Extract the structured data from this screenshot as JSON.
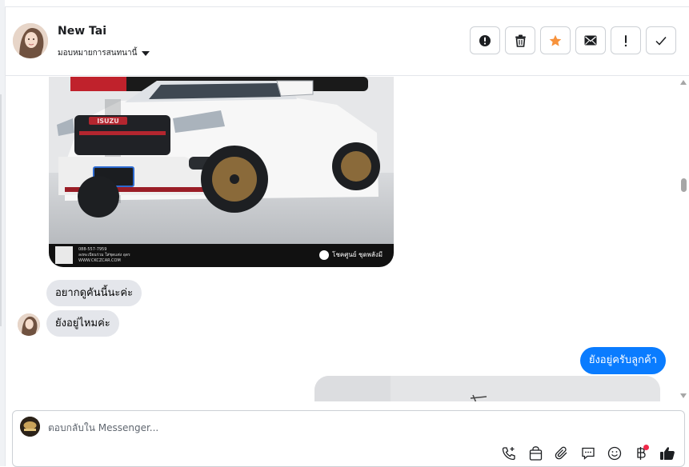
{
  "header": {
    "contact_name": "New Tai",
    "assign_label": "มอบหมายการสนทนานี้",
    "actions": [
      {
        "icon": "alert-circle-icon",
        "name": "mark-spam-button"
      },
      {
        "icon": "trash-icon",
        "name": "delete-button"
      },
      {
        "icon": "star-icon",
        "name": "star-button"
      },
      {
        "icon": "envelope-icon",
        "name": "mark-unread-button"
      },
      {
        "icon": "exclamation-icon",
        "name": "follow-up-button"
      },
      {
        "icon": "check-icon",
        "name": "mark-done-button"
      }
    ]
  },
  "colors": {
    "accent": "#0a7cff",
    "star": "#f7923b",
    "incoming_bubble": "#e4e6eb",
    "notification_dot": "#f02849"
  },
  "messages": {
    "image_footer": {
      "phone": "088-557-7959",
      "facebook": "ลงทะเบียนร่วม ใส่ชุดแต่ง อุดร",
      "website": "WWW.CKCZCAR.COM",
      "brand": "โชคศูนย์ ชุดพลังมี"
    },
    "incoming_1": "อยากดูคันนี้นะค่ะ",
    "incoming_2": "ยังอยู่ไหมค่ะ",
    "outgoing_1": "ยังอยู่ครับลูกค้า"
  },
  "composer": {
    "placeholder": "ตอบกลับใน Messenger...",
    "tools": [
      "phone-plus-icon",
      "shopping-bag-icon",
      "paperclip-icon",
      "chat-bubble-icon",
      "smiley-icon",
      "baht-icon",
      "thumbs-up-icon"
    ]
  }
}
